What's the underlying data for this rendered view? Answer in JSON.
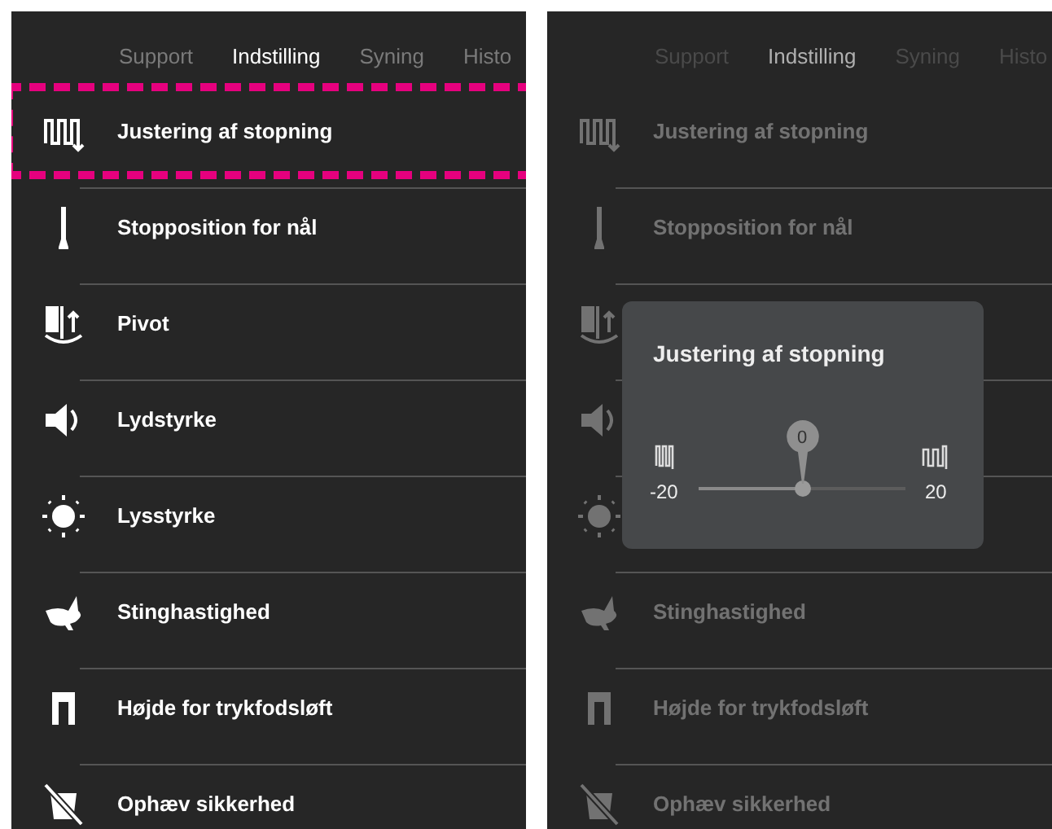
{
  "screens": [
    {
      "dimmed": false,
      "tabs": [
        {
          "label": "Support",
          "selected": false
        },
        {
          "label": "Indstilling",
          "selected": true
        },
        {
          "label": "Syning",
          "selected": false
        },
        {
          "label": "Histo",
          "selected": false
        }
      ],
      "items": [
        {
          "kind": "stitch",
          "label": "Justering af stopning",
          "highlighted": true
        },
        {
          "kind": "needle",
          "label": "Stopposition for nål",
          "highlighted": false
        },
        {
          "kind": "pivot",
          "label": "Pivot",
          "highlighted": false
        },
        {
          "kind": "volume",
          "label": "Lydstyrke",
          "highlighted": false
        },
        {
          "kind": "brightness",
          "label": "Lysstyrke",
          "highlighted": false
        },
        {
          "kind": "speed",
          "label": "Stinghastighed",
          "highlighted": false
        },
        {
          "kind": "lift",
          "label": "Højde for trykfodsløft",
          "highlighted": false
        },
        {
          "kind": "safety",
          "label": "Ophæv sikkerhed",
          "highlighted": false
        }
      ]
    },
    {
      "dimmed": true,
      "tabs": [
        {
          "label": "Support",
          "selected": false
        },
        {
          "label": "Indstilling",
          "selected": true
        },
        {
          "label": "Syning",
          "selected": false
        },
        {
          "label": "Histo",
          "selected": false
        }
      ],
      "items": [
        {
          "kind": "stitch",
          "label": "Justering af stopning"
        },
        {
          "kind": "needle",
          "label": "Stopposition for nål"
        },
        {
          "kind": "pivot"
        },
        {
          "kind": "volume"
        },
        {
          "kind": "brightness"
        },
        {
          "kind": "speed",
          "label": "Stinghastighed"
        },
        {
          "kind": "lift",
          "label": "Højde for trykfodsløft"
        },
        {
          "kind": "safety",
          "label": "Ophæv sikkerhed"
        }
      ],
      "dialog": {
        "title": "Justering af stopning",
        "min": "-20",
        "max": "20",
        "value": "0",
        "level": 0.5
      }
    }
  ]
}
